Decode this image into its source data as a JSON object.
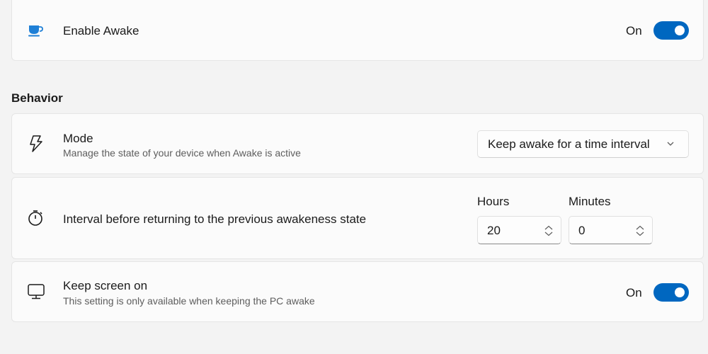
{
  "enable_awake": {
    "icon": "coffee-cup-icon",
    "title": "Enable Awake",
    "toggle_state_label": "On",
    "toggle_on": true
  },
  "behavior": {
    "section_title": "Behavior",
    "mode": {
      "icon": "lightning-bolt-icon",
      "title": "Mode",
      "description": "Manage the state of your device when Awake is active",
      "selected_option": "Keep awake for a time interval"
    },
    "interval": {
      "icon": "stopwatch-icon",
      "title": "Interval before returning to the previous awakeness state",
      "hours_label": "Hours",
      "hours_value": "20",
      "minutes_label": "Minutes",
      "minutes_value": "0"
    },
    "keep_screen_on": {
      "icon": "monitor-icon",
      "title": "Keep screen on",
      "description": "This setting is only available when keeping the PC awake",
      "toggle_state_label": "On",
      "toggle_on": true
    }
  },
  "colors": {
    "accent": "#0067c0",
    "cup_icon": "#1e7fd6"
  }
}
